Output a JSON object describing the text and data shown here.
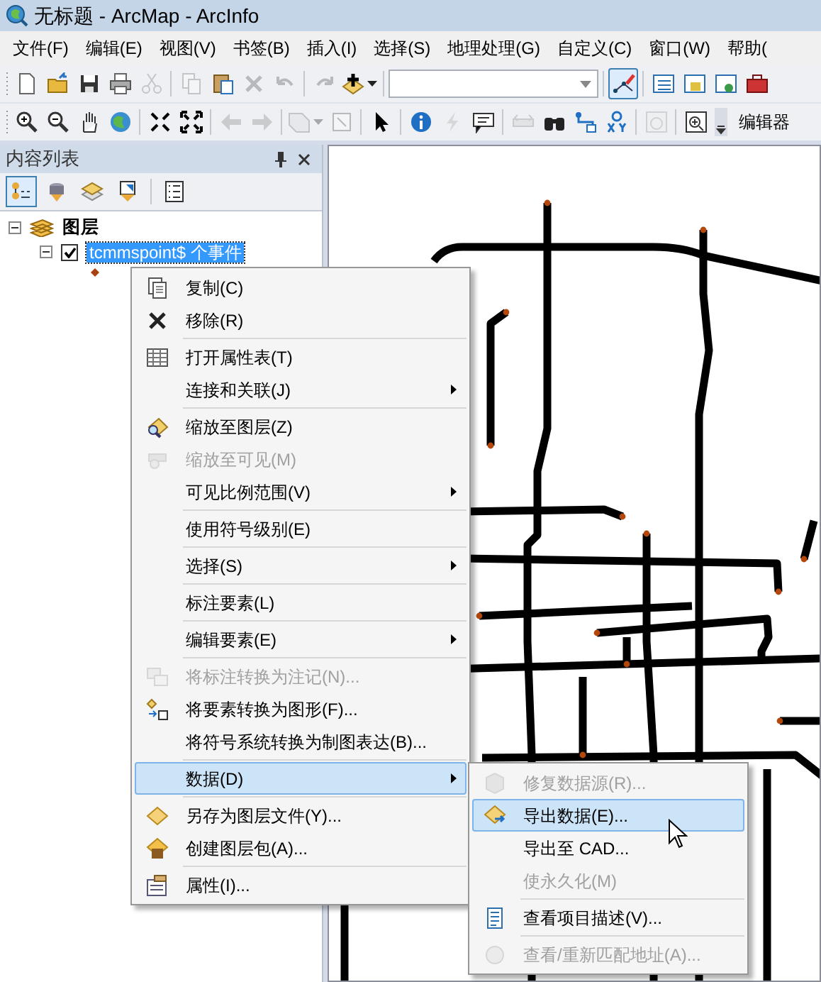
{
  "window": {
    "title": "无标题 - ArcMap - ArcInfo"
  },
  "menubar": [
    "文件(F)",
    "编辑(E)",
    "视图(V)",
    "书签(B)",
    "插入(I)",
    "选择(S)",
    "地理处理(G)",
    "自定义(C)",
    "窗口(W)",
    "帮助("
  ],
  "toolbar_1": {
    "buttons": [
      {
        "disabled": false,
        "selected": false
      },
      {
        "disabled": false,
        "selected": false
      },
      {
        "disabled": false,
        "selected": false
      },
      {
        "disabled": false,
        "selected": false
      },
      {
        "disabled": true,
        "selected": false
      },
      {
        "disabled": true,
        "selected": false
      },
      {
        "disabled": false,
        "selected": false
      },
      {
        "disabled": true,
        "selected": false
      },
      {
        "disabled": true,
        "selected": false
      },
      {
        "disabled": true,
        "selected": false
      },
      {
        "disabled": false,
        "selected": false
      },
      {
        "disabled": false,
        "selected": false
      },
      {
        "disabled": false,
        "selected": true
      },
      {
        "disabled": false,
        "selected": false
      },
      {
        "disabled": false,
        "selected": false
      },
      {
        "disabled": false,
        "selected": false
      },
      {
        "disabled": false,
        "selected": false
      }
    ]
  },
  "toolbar_2": {
    "buttons": [
      {
        "disabled": false,
        "selected": false
      },
      {
        "disabled": false,
        "selected": false
      },
      {
        "disabled": false,
        "selected": false
      },
      {
        "disabled": false,
        "selected": false
      },
      {
        "disabled": false,
        "selected": false
      },
      {
        "disabled": false,
        "selected": false
      },
      {
        "disabled": true,
        "selected": false
      },
      {
        "disabled": true,
        "selected": false
      },
      {
        "disabled": true,
        "selected": false
      },
      {
        "disabled": true,
        "selected": false
      },
      {
        "disabled": false,
        "selected": false
      },
      {
        "disabled": false,
        "selected": false
      },
      {
        "disabled": true,
        "selected": false
      },
      {
        "disabled": false,
        "selected": false
      },
      {
        "disabled": true,
        "selected": false
      },
      {
        "disabled": false,
        "selected": false
      },
      {
        "disabled": false,
        "selected": false
      },
      {
        "disabled": false,
        "selected": false
      },
      {
        "disabled": true,
        "selected": false
      },
      {
        "disabled": false,
        "selected": false
      }
    ],
    "label": "编辑器"
  },
  "toc": {
    "title": "内容列表",
    "view_buttons": [
      {
        "selected": true
      },
      {
        "selected": false
      },
      {
        "selected": false
      },
      {
        "selected": false
      },
      {
        "selected": false
      }
    ],
    "tree": [
      {
        "label": "图层",
        "expanded": true,
        "children": [
          {
            "label": "tcmmspoint$ 个事件",
            "checked": true,
            "expanded": true,
            "selected": true
          }
        ]
      }
    ]
  },
  "context_menu": {
    "items": [
      {
        "kind": "item",
        "label": "复制(C)",
        "disabled": false,
        "selected": false,
        "submenu": false
      },
      {
        "kind": "item",
        "label": "移除(R)",
        "disabled": false,
        "selected": false,
        "submenu": false
      },
      {
        "kind": "separator"
      },
      {
        "kind": "item",
        "label": "打开属性表(T)",
        "disabled": false,
        "selected": false,
        "submenu": false
      },
      {
        "kind": "item",
        "label": "连接和关联(J)",
        "disabled": false,
        "selected": false,
        "submenu": true
      },
      {
        "kind": "separator"
      },
      {
        "kind": "item",
        "label": "缩放至图层(Z)",
        "disabled": false,
        "selected": false,
        "submenu": false
      },
      {
        "kind": "item",
        "label": "缩放至可见(M)",
        "disabled": true,
        "selected": false,
        "submenu": false
      },
      {
        "kind": "item",
        "label": "可见比例范围(V)",
        "disabled": false,
        "selected": false,
        "submenu": true
      },
      {
        "kind": "separator"
      },
      {
        "kind": "item",
        "label": "使用符号级别(E)",
        "disabled": false,
        "selected": false,
        "submenu": false
      },
      {
        "kind": "separator"
      },
      {
        "kind": "item",
        "label": "选择(S)",
        "disabled": false,
        "selected": false,
        "submenu": true
      },
      {
        "kind": "separator"
      },
      {
        "kind": "item",
        "label": "标注要素(L)",
        "disabled": false,
        "selected": false,
        "submenu": false
      },
      {
        "kind": "separator"
      },
      {
        "kind": "item",
        "label": "编辑要素(E)",
        "disabled": false,
        "selected": false,
        "submenu": true
      },
      {
        "kind": "separator"
      },
      {
        "kind": "item",
        "label": "将标注转换为注记(N)...",
        "disabled": true,
        "selected": false,
        "submenu": false
      },
      {
        "kind": "item",
        "label": "将要素转换为图形(F)...",
        "disabled": false,
        "selected": false,
        "submenu": false
      },
      {
        "kind": "item",
        "label": "将符号系统转换为制图表达(B)...",
        "disabled": false,
        "selected": false,
        "submenu": false
      },
      {
        "kind": "separator"
      },
      {
        "kind": "item",
        "label": "数据(D)",
        "disabled": false,
        "selected": true,
        "submenu": true
      },
      {
        "kind": "separator"
      },
      {
        "kind": "item",
        "label": "另存为图层文件(Y)...",
        "disabled": false,
        "selected": false,
        "submenu": false
      },
      {
        "kind": "item",
        "label": "创建图层包(A)...",
        "disabled": false,
        "selected": false,
        "submenu": false
      },
      {
        "kind": "separator"
      },
      {
        "kind": "item",
        "label": "属性(I)...",
        "disabled": false,
        "selected": false,
        "submenu": false
      }
    ]
  },
  "submenu": {
    "items": [
      {
        "kind": "item",
        "label": "修复数据源(R)...",
        "disabled": true,
        "selected": false
      },
      {
        "kind": "item",
        "label": "导出数据(E)...",
        "disabled": false,
        "selected": true
      },
      {
        "kind": "item",
        "label": "导出至 CAD...",
        "disabled": false,
        "selected": false
      },
      {
        "kind": "item",
        "label": "使永久化(M)",
        "disabled": true,
        "selected": false
      },
      {
        "kind": "separator"
      },
      {
        "kind": "item",
        "label": "查看项目描述(V)...",
        "disabled": false,
        "selected": false
      },
      {
        "kind": "separator"
      },
      {
        "kind": "item",
        "label": "查看/重新匹配地址(A)...",
        "disabled": true,
        "selected": false
      }
    ]
  }
}
